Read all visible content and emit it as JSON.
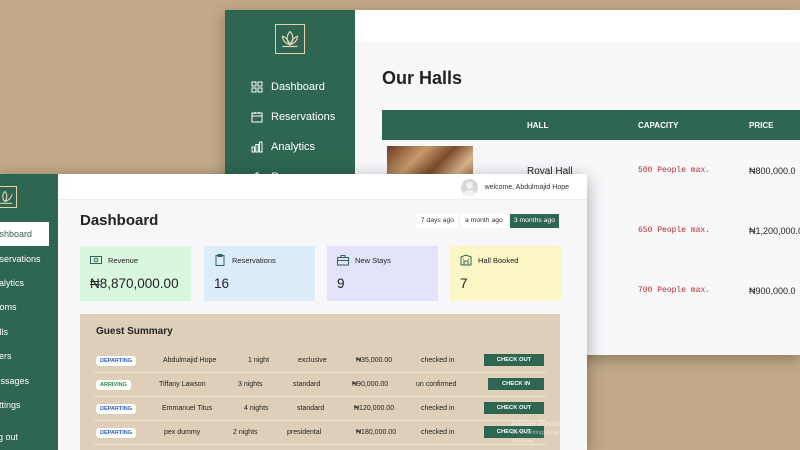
{
  "halls_window": {
    "title": "Our Halls",
    "nav": [
      {
        "label": "Dashboard",
        "icon": "grid-icon"
      },
      {
        "label": "Reservations",
        "icon": "calendar-icon"
      },
      {
        "label": "Analytics",
        "icon": "bar-chart-icon"
      },
      {
        "label": "Rooms",
        "icon": "home-icon"
      }
    ],
    "columns": [
      "HALL",
      "CAPACITY",
      "PRICE"
    ],
    "rows": [
      {
        "name": "Royal Hall",
        "capacity": "500 People max.",
        "price": "₦800,000.0"
      },
      {
        "name": "",
        "capacity": "650 People max.",
        "price": "₦1,200,000.0"
      },
      {
        "name": "",
        "capacity": "700 People max.",
        "price": "₦900,000.0"
      }
    ]
  },
  "dashboard_window": {
    "welcome": "welcome, Abdulmajid Hope",
    "title": "Dashboard",
    "nav": [
      {
        "label": "Dashboard",
        "active": true
      },
      {
        "label": "Reservations"
      },
      {
        "label": "Analytics"
      },
      {
        "label": "Rooms"
      },
      {
        "label": "Halls"
      },
      {
        "label": "Users"
      },
      {
        "label": "Messages"
      },
      {
        "label": "Settings"
      },
      {
        "label": "Log out"
      }
    ],
    "ranges": [
      "7 days ago",
      "a month ago",
      "3 months ago"
    ],
    "selected_range": "3 months ago",
    "cards": [
      {
        "label": "Revenue",
        "value": "₦8,870,000.00",
        "icon": "money-icon",
        "color": "#d9f7de"
      },
      {
        "label": "Reservations",
        "value": "16",
        "icon": "clipboard-icon",
        "color": "#dcecfb"
      },
      {
        "label": "New Stays",
        "value": "9",
        "icon": "suitcase-icon",
        "color": "#e2e2fb"
      },
      {
        "label": "Hall Booked",
        "value": "7",
        "icon": "building-icon",
        "color": "#fbf6c6"
      }
    ],
    "guest_summary": {
      "title": "Guest Summary",
      "rows": [
        {
          "status": "DEPARTING",
          "name": "Abdulmajid Hope",
          "nights": "1 night",
          "room": "exclusive",
          "amount": "₦35,000.00",
          "state": "checked in",
          "action": "CHECK OUT"
        },
        {
          "status": "ARRIVING",
          "name": "Tiffany Lawson",
          "nights": "3 nights",
          "room": "standard",
          "amount": "₦90,000.00",
          "state": "un confirmed",
          "action": "CHECK IN"
        },
        {
          "status": "DEPARTING",
          "name": "Emmanuel Titus",
          "nights": "4 nights",
          "room": "standard",
          "amount": "₦120,000.00",
          "state": "checked in",
          "action": "CHECK OUT"
        },
        {
          "status": "DEPARTING",
          "name": "pex dummy",
          "nights": "2 nights",
          "room": "presidental",
          "amount": "₦180,000.00",
          "state": "checked in",
          "action": "CHECK OUT"
        }
      ]
    },
    "watermark": {
      "line1": "Activate Windows",
      "line2": "Go to Settings to activate Windows."
    }
  },
  "colors": {
    "brand_green": "#2e6651",
    "beige": "#c2a988",
    "panel_tan": "#dfcfb8"
  }
}
